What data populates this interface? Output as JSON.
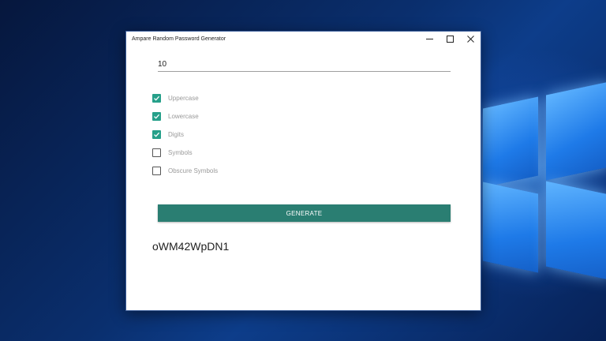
{
  "window": {
    "title": "Ampare Random Password Generator"
  },
  "length_field": {
    "value": "10"
  },
  "options": [
    {
      "label": "Uppercase",
      "checked": true
    },
    {
      "label": "Lowercase",
      "checked": true
    },
    {
      "label": "Digits",
      "checked": true
    },
    {
      "label": "Symbols",
      "checked": false
    },
    {
      "label": "Obscure Symbols",
      "checked": false
    }
  ],
  "generate_button": {
    "label": "GENERATE"
  },
  "result": {
    "password": "oWM42WpDN1"
  },
  "icons": {
    "minimize": "minimize-icon",
    "maximize": "maximize-icon",
    "close": "close-icon",
    "checkmark": "checkmark-icon"
  },
  "colors": {
    "accent": "#26a08a",
    "button": "#2a7e72",
    "desktop": "#0a2f6e"
  }
}
